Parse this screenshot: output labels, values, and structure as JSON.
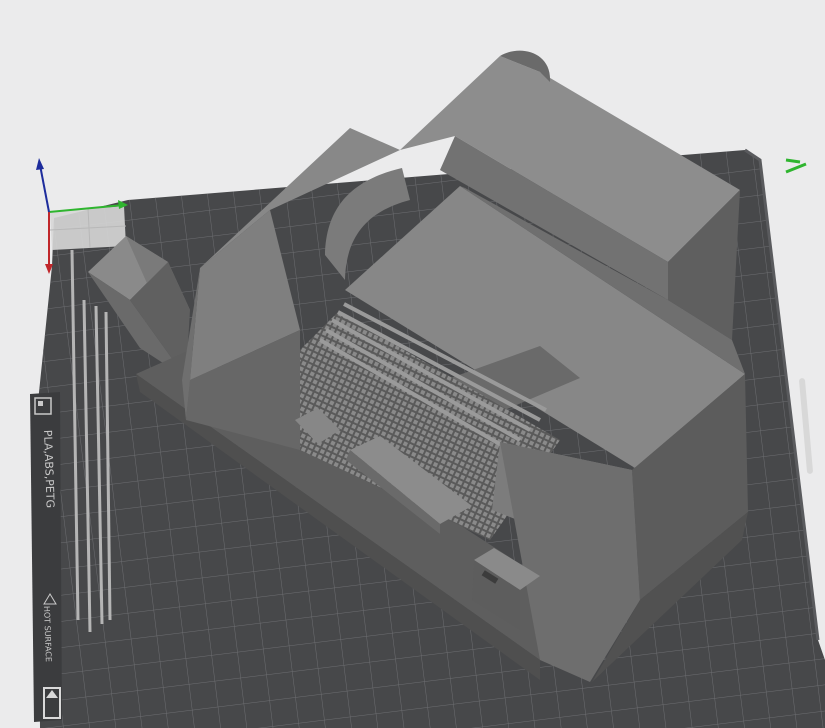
{
  "viewport": {
    "background": "#ebebec",
    "plate_color": "#4a4b4d",
    "plate_grid_color": "#7a7b7e",
    "model_color": "#7d7d7d"
  },
  "build_plate": {
    "label": "PLA,ABS,PETG",
    "warning": "HOT SURFACE",
    "corner_mark": "—",
    "icons": [
      "plate-type-icon",
      "warning-triangle-icon",
      "arrow-icon"
    ]
  },
  "axes": {
    "x_color": "#2fb52f",
    "y_color": "#c0262a",
    "z_color": "#1d2c9c"
  }
}
